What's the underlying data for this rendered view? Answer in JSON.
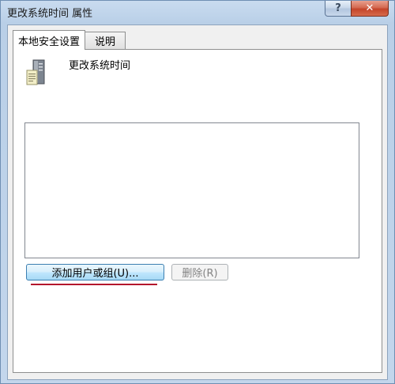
{
  "window": {
    "title": "更改系统时间 属性"
  },
  "titlebar": {
    "help_label": "?",
    "close_label": "✕"
  },
  "tabs": [
    {
      "label": "本地安全设置",
      "active": true
    },
    {
      "label": "说明",
      "active": false
    }
  ],
  "policy": {
    "name": "更改系统时间",
    "icon": "server-policy-icon"
  },
  "buttons": {
    "add_label": "添加用户或组(U)...",
    "remove_label": "删除(R)"
  },
  "colors": {
    "underline": "#b3142b",
    "close_button": "#c4442a"
  }
}
